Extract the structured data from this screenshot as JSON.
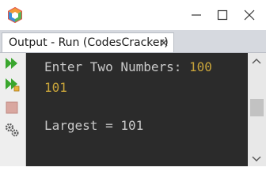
{
  "window": {
    "logo_icon": "app-logo-icon",
    "minimize_icon": "minimize-icon",
    "maximize_icon": "maximize-icon",
    "close_icon": "close-icon"
  },
  "tab": {
    "label": "Output - Run (CodesCracker)",
    "close_icon": "close-icon"
  },
  "toolbar": {
    "items": [
      {
        "icon": "rerun-icon"
      },
      {
        "icon": "rerun-with-different-parameters-icon"
      },
      {
        "icon": "stop-icon"
      },
      {
        "icon": "settings-icon"
      }
    ]
  },
  "console": {
    "prompt": "Enter Two Numbers: ",
    "input_first": "100",
    "input_second": "101",
    "result": "Largest = 101"
  },
  "colors": {
    "console_background": "#2b2b2b",
    "output_text": "#c9c9c9",
    "input_text": "#c8a43a",
    "run_icon": "#3aa62e"
  }
}
